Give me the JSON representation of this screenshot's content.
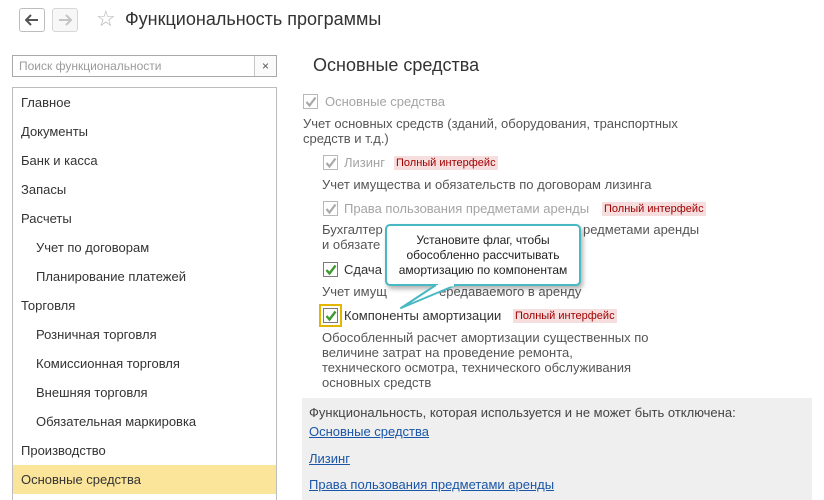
{
  "window": {
    "title": "Функциональность программы"
  },
  "search": {
    "placeholder": "Поиск функциональности",
    "clear_symbol": "×"
  },
  "sidebar": {
    "items": [
      {
        "label": "Главное"
      },
      {
        "label": "Документы"
      },
      {
        "label": "Банк и касса"
      },
      {
        "label": "Запасы"
      },
      {
        "label": "Расчеты"
      },
      {
        "label": "Учет по договорам"
      },
      {
        "label": "Планирование платежей"
      },
      {
        "label": "Торговля"
      },
      {
        "label": "Розничная торговля"
      },
      {
        "label": "Комиссионная торговля"
      },
      {
        "label": "Внешняя торговля"
      },
      {
        "label": "Обязательная маркировка"
      },
      {
        "label": "Производство"
      },
      {
        "label": "Основные средства",
        "selected": true
      }
    ]
  },
  "main": {
    "title": "Основные средства",
    "options": [
      {
        "label": "Основные средства",
        "checked": true,
        "enabled": false,
        "description": "Учет основных средств (зданий, оборудования, транспортных средств и т.д.)"
      },
      {
        "label": "Лизинг",
        "checked": true,
        "enabled": false,
        "badge": "Полный интерфейс",
        "description": "Учет имущества и обязательств  по договорам лизинга"
      },
      {
        "label": "Права пользования предметами аренды",
        "checked": true,
        "enabled": false,
        "badge": "Полный интерфейс",
        "description_l1": "Бухгалтер",
        "description_l1_end": "редметами аренды",
        "description_l2": "и обязате"
      },
      {
        "label": "Сдача",
        "checked": true,
        "enabled": true,
        "description_start": "Учет имущ",
        "description_end": "ередаваемого в аренду"
      },
      {
        "label": "Компоненты амортизации",
        "checked": true,
        "enabled": true,
        "badge": "Полный интерфейс",
        "description_lines": [
          "Обособленный расчет амортизации существенных по",
          "величине затрат на проведение ремонта,",
          "технического осмотра, технического обслуживания",
          "основных средств"
        ]
      }
    ]
  },
  "fixed_panel": {
    "title": "Функциональность, которая используется и не может быть отключена:",
    "links": [
      "Основные средства",
      "Лизинг",
      "Права пользования предметами аренды"
    ]
  },
  "tooltip": {
    "lines": [
      "Установите флаг, чтобы",
      "обособленно рассчитывать",
      "амортизацию по компонентам"
    ]
  },
  "icons": {
    "back": "arrow-left-icon",
    "forward": "arrow-right-icon",
    "favorite": "star-icon",
    "checkbox": "checkmark-icon"
  },
  "colors": {
    "selected_bg": "#fbe59b",
    "badge_text": "#a00000",
    "badge_bg": "#f7dede",
    "link": "#1a56a8",
    "check_green": "#3c9a2f",
    "tooltip_border": "#48b8c2",
    "focus_border": "#e4b600"
  }
}
